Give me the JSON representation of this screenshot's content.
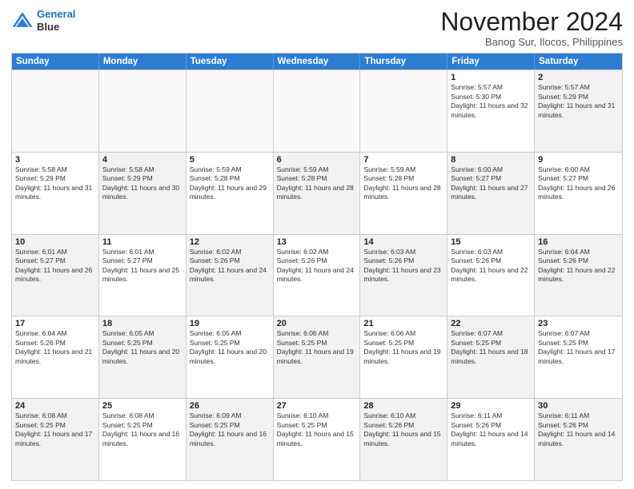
{
  "header": {
    "logo_line1": "General",
    "logo_line2": "Blue",
    "month": "November 2024",
    "location": "Banog Sur, Ilocos, Philippines"
  },
  "weekdays": [
    "Sunday",
    "Monday",
    "Tuesday",
    "Wednesday",
    "Thursday",
    "Friday",
    "Saturday"
  ],
  "rows": [
    [
      {
        "day": "",
        "info": "",
        "empty": true
      },
      {
        "day": "",
        "info": "",
        "empty": true
      },
      {
        "day": "",
        "info": "",
        "empty": true
      },
      {
        "day": "",
        "info": "",
        "empty": true
      },
      {
        "day": "",
        "info": "",
        "empty": true
      },
      {
        "day": "1",
        "info": "Sunrise: 5:57 AM\nSunset: 5:30 PM\nDaylight: 11 hours and 32 minutes."
      },
      {
        "day": "2",
        "info": "Sunrise: 5:57 AM\nSunset: 5:29 PM\nDaylight: 11 hours and 31 minutes.",
        "alt": true
      }
    ],
    [
      {
        "day": "3",
        "info": "Sunrise: 5:58 AM\nSunset: 5:29 PM\nDaylight: 11 hours and 31 minutes."
      },
      {
        "day": "4",
        "info": "Sunrise: 5:58 AM\nSunset: 5:29 PM\nDaylight: 11 hours and 30 minutes.",
        "alt": true
      },
      {
        "day": "5",
        "info": "Sunrise: 5:59 AM\nSunset: 5:28 PM\nDaylight: 11 hours and 29 minutes."
      },
      {
        "day": "6",
        "info": "Sunrise: 5:59 AM\nSunset: 5:28 PM\nDaylight: 11 hours and 28 minutes.",
        "alt": true
      },
      {
        "day": "7",
        "info": "Sunrise: 5:59 AM\nSunset: 5:28 PM\nDaylight: 11 hours and 28 minutes."
      },
      {
        "day": "8",
        "info": "Sunrise: 6:00 AM\nSunset: 5:27 PM\nDaylight: 11 hours and 27 minutes.",
        "alt": true
      },
      {
        "day": "9",
        "info": "Sunrise: 6:00 AM\nSunset: 5:27 PM\nDaylight: 11 hours and 26 minutes."
      }
    ],
    [
      {
        "day": "10",
        "info": "Sunrise: 6:01 AM\nSunset: 5:27 PM\nDaylight: 11 hours and 26 minutes.",
        "alt": true
      },
      {
        "day": "11",
        "info": "Sunrise: 6:01 AM\nSunset: 5:27 PM\nDaylight: 11 hours and 25 minutes."
      },
      {
        "day": "12",
        "info": "Sunrise: 6:02 AM\nSunset: 5:26 PM\nDaylight: 11 hours and 24 minutes.",
        "alt": true
      },
      {
        "day": "13",
        "info": "Sunrise: 6:02 AM\nSunset: 5:26 PM\nDaylight: 11 hours and 24 minutes."
      },
      {
        "day": "14",
        "info": "Sunrise: 6:03 AM\nSunset: 5:26 PM\nDaylight: 11 hours and 23 minutes.",
        "alt": true
      },
      {
        "day": "15",
        "info": "Sunrise: 6:03 AM\nSunset: 5:26 PM\nDaylight: 11 hours and 22 minutes."
      },
      {
        "day": "16",
        "info": "Sunrise: 6:04 AM\nSunset: 5:26 PM\nDaylight: 11 hours and 22 minutes.",
        "alt": true
      }
    ],
    [
      {
        "day": "17",
        "info": "Sunrise: 6:04 AM\nSunset: 5:26 PM\nDaylight: 11 hours and 21 minutes."
      },
      {
        "day": "18",
        "info": "Sunrise: 6:05 AM\nSunset: 5:25 PM\nDaylight: 11 hours and 20 minutes.",
        "alt": true
      },
      {
        "day": "19",
        "info": "Sunrise: 6:05 AM\nSunset: 5:25 PM\nDaylight: 11 hours and 20 minutes."
      },
      {
        "day": "20",
        "info": "Sunrise: 6:06 AM\nSunset: 5:25 PM\nDaylight: 11 hours and 19 minutes.",
        "alt": true
      },
      {
        "day": "21",
        "info": "Sunrise: 6:06 AM\nSunset: 5:25 PM\nDaylight: 11 hours and 19 minutes."
      },
      {
        "day": "22",
        "info": "Sunrise: 6:07 AM\nSunset: 5:25 PM\nDaylight: 11 hours and 18 minutes.",
        "alt": true
      },
      {
        "day": "23",
        "info": "Sunrise: 6:07 AM\nSunset: 5:25 PM\nDaylight: 11 hours and 17 minutes."
      }
    ],
    [
      {
        "day": "24",
        "info": "Sunrise: 6:08 AM\nSunset: 5:25 PM\nDaylight: 11 hours and 17 minutes.",
        "alt": true
      },
      {
        "day": "25",
        "info": "Sunrise: 6:08 AM\nSunset: 5:25 PM\nDaylight: 11 hours and 16 minutes."
      },
      {
        "day": "26",
        "info": "Sunrise: 6:09 AM\nSunset: 5:25 PM\nDaylight: 11 hours and 16 minutes.",
        "alt": true
      },
      {
        "day": "27",
        "info": "Sunrise: 6:10 AM\nSunset: 5:25 PM\nDaylight: 11 hours and 15 minutes."
      },
      {
        "day": "28",
        "info": "Sunrise: 6:10 AM\nSunset: 5:26 PM\nDaylight: 11 hours and 15 minutes.",
        "alt": true
      },
      {
        "day": "29",
        "info": "Sunrise: 6:11 AM\nSunset: 5:26 PM\nDaylight: 11 hours and 14 minutes."
      },
      {
        "day": "30",
        "info": "Sunrise: 6:11 AM\nSunset: 5:26 PM\nDaylight: 11 hours and 14 minutes.",
        "alt": true
      }
    ]
  ]
}
